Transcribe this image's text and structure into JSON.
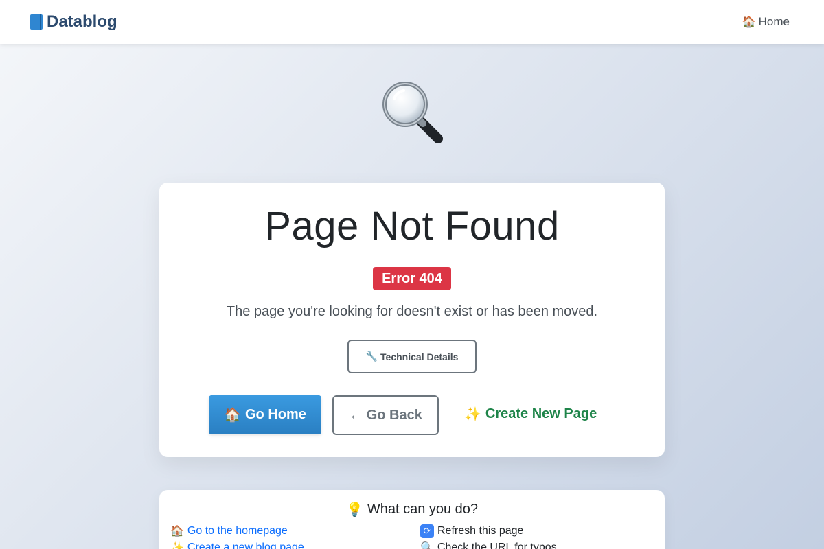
{
  "navbar": {
    "brand_label": "Datablog",
    "home_label": "Home"
  },
  "main": {
    "title": "Page Not Found",
    "badge": "Error 404",
    "message": "The page you're looking for doesn't exist or has been moved.",
    "technical_details_label": "Technical Details",
    "go_home_label": "Go Home",
    "go_back_label": "← Go Back",
    "create_label": "Create New Page"
  },
  "help": {
    "title": "What can you do?",
    "items": [
      {
        "label": "Go to the homepage",
        "icon": "house-icon",
        "link": true
      },
      {
        "label": "Create a new blog page",
        "icon": "sparkles-icon",
        "link": true
      },
      {
        "label": "Refresh this page",
        "icon": "refresh-icon",
        "link": false
      },
      {
        "label": "Check the URL for typos",
        "icon": "search-icon",
        "link": false
      }
    ]
  },
  "colors": {
    "primary": "#2f86d1",
    "danger": "#dc3545",
    "success": "#1e8449",
    "secondary": "#6c757d"
  }
}
